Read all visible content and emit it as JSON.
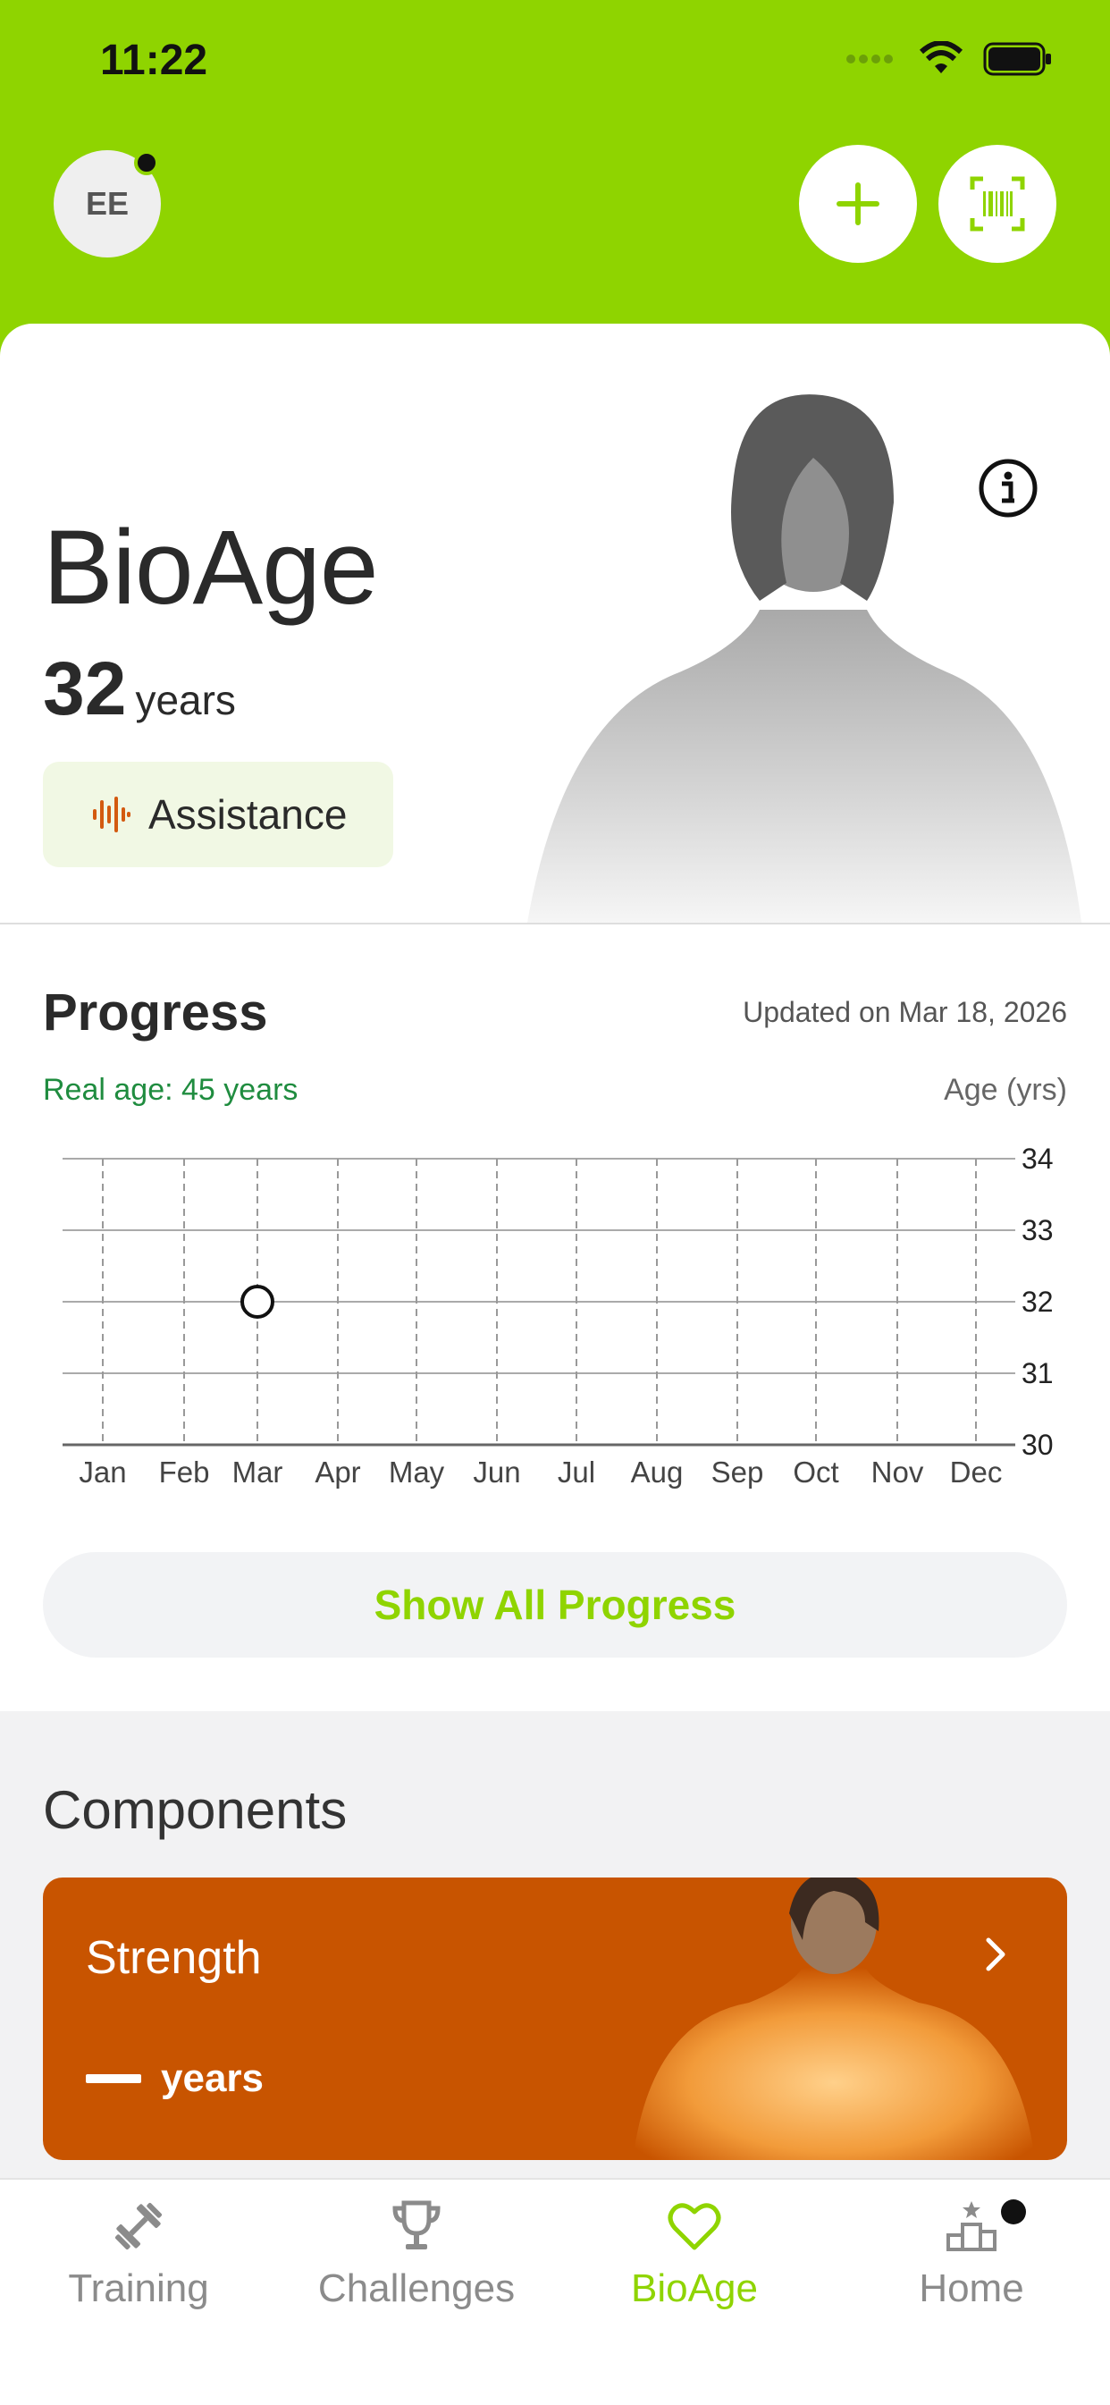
{
  "status": {
    "time": "11:22"
  },
  "header": {
    "avatar_initials": "EE"
  },
  "hero": {
    "title": "BioAge",
    "age_value": "32",
    "age_unit": "years",
    "assistance_label": "Assistance"
  },
  "progress": {
    "title": "Progress",
    "updated": "Updated on Mar 18, 2026",
    "real_age": "Real age: 45 years",
    "y_unit": "Age (yrs)",
    "show_all_label": "Show All Progress"
  },
  "chart_data": {
    "type": "scatter",
    "x": [
      "Jan",
      "Feb",
      "Mar",
      "Apr",
      "May",
      "Jun",
      "Jul",
      "Aug",
      "Sep",
      "Oct",
      "Nov",
      "Dec"
    ],
    "y_ticks": [
      30,
      31,
      32,
      33,
      34
    ],
    "ylim": [
      30,
      34
    ],
    "points": [
      {
        "x": "Mar",
        "y": 32
      }
    ],
    "grid": true
  },
  "components": {
    "title": "Components",
    "items": [
      {
        "name": "Strength",
        "value": "—",
        "unit": "years"
      }
    ]
  },
  "tabs": [
    {
      "label": "Training",
      "icon": "dumbbell-icon",
      "active": false
    },
    {
      "label": "Challenges",
      "icon": "trophy-icon",
      "active": false
    },
    {
      "label": "BioAge",
      "icon": "heart-icon",
      "active": true
    },
    {
      "label": "Home",
      "icon": "podium-icon",
      "active": false
    }
  ],
  "colors": {
    "brand_green": "#8fd400",
    "component_orange": "#c85400",
    "real_age_green": "#1f8c3f"
  }
}
